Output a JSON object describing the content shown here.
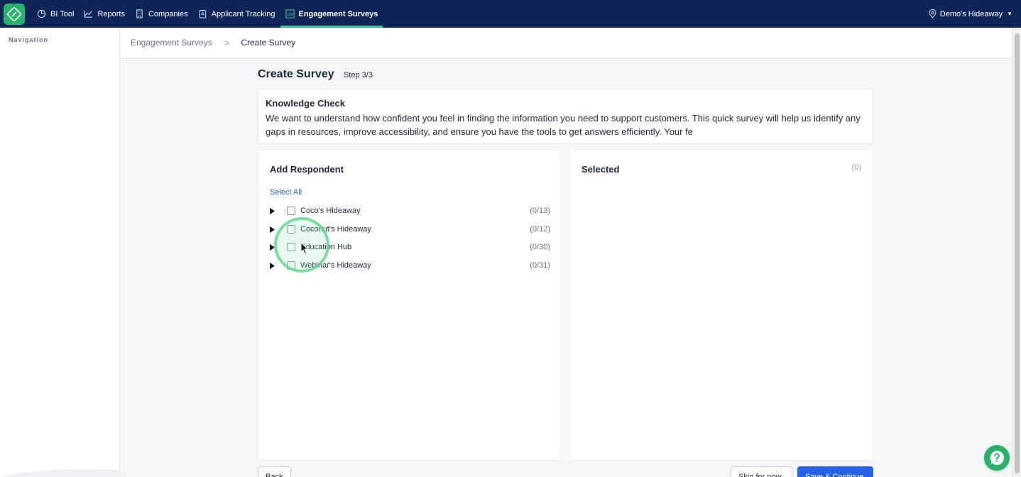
{
  "topnav": {
    "items": [
      {
        "label": "BI Tool",
        "icon": "pie-chart-icon"
      },
      {
        "label": "Reports",
        "icon": "line-chart-icon"
      },
      {
        "label": "Companies",
        "icon": "building-icon"
      },
      {
        "label": "Applicant Tracking",
        "icon": "clipboard-icon"
      },
      {
        "label": "Engagement Surveys",
        "icon": "bar-chart-icon",
        "active": true
      }
    ],
    "location": "Demo's Hideaway",
    "brand_color": "#27b36a",
    "bar_color": "#0f2557",
    "active_underline_color": "#2fc38d"
  },
  "sidebar": {
    "title": "Navigation"
  },
  "breadcrumb": {
    "parent": "Engagement Surveys",
    "separator": ">",
    "current": "Create Survey"
  },
  "page": {
    "title": "Create Survey",
    "step": "Step 3/3"
  },
  "survey": {
    "name": "Knowledge Check",
    "description": "We want to understand how confident you feel in finding the information you need to support customers. This quick survey will help us identify any gaps in resources, improve accessibility, and ensure you have the tools to get answers efficiently. Your fe"
  },
  "respondents": {
    "title": "Add Respondent",
    "select_all": "Select All",
    "groups": [
      {
        "name": "Coco's Hideaway",
        "count": "(0/13)"
      },
      {
        "name": "Coconut's Hideaway",
        "count": "(0/12)"
      },
      {
        "name": "Education Hub",
        "count": "(0/30)"
      },
      {
        "name": "Webinar's Hideaway",
        "count": "(0/31)"
      }
    ]
  },
  "selected": {
    "title": "Selected",
    "count": "(0)"
  },
  "footer": {
    "back": "Back",
    "skip": "Skip for now",
    "save": "Save & Continue",
    "primary_color": "#2563eb"
  }
}
